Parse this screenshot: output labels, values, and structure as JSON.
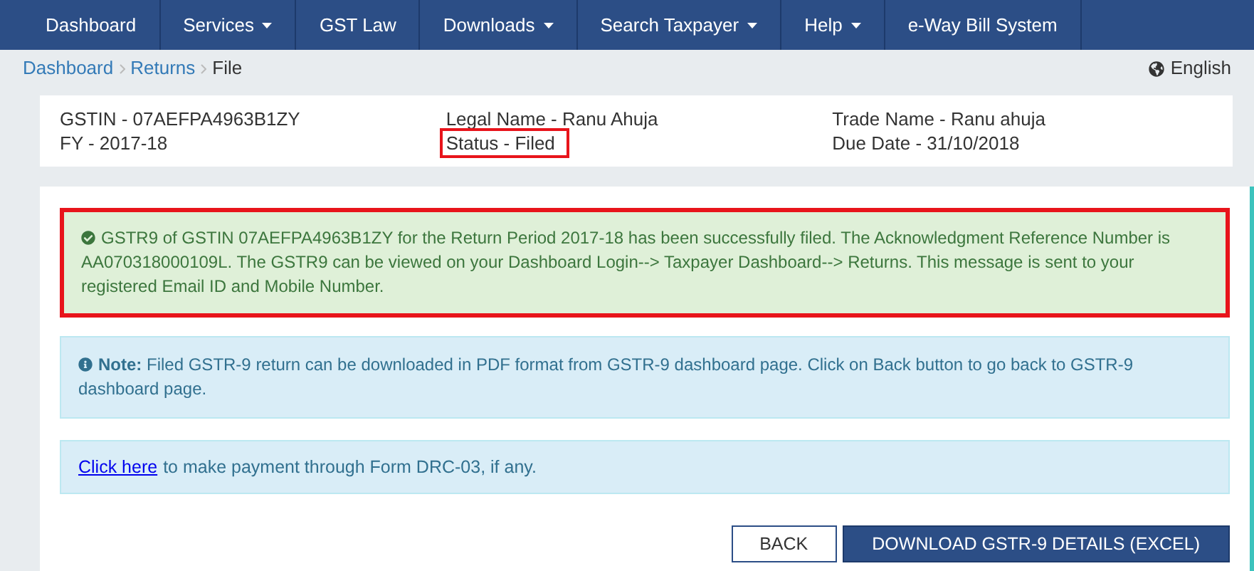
{
  "nav": [
    {
      "label": "Dashboard",
      "dropdown": false
    },
    {
      "label": "Services",
      "dropdown": true
    },
    {
      "label": "GST Law",
      "dropdown": false
    },
    {
      "label": "Downloads",
      "dropdown": true
    },
    {
      "label": "Search Taxpayer",
      "dropdown": true
    },
    {
      "label": "Help",
      "dropdown": true
    },
    {
      "label": "e-Way Bill System",
      "dropdown": false
    }
  ],
  "breadcrumb": [
    {
      "label": "Dashboard",
      "link": true
    },
    {
      "label": "Returns",
      "link": true
    },
    {
      "label": "File",
      "link": false
    }
  ],
  "language": "English",
  "info": [
    [
      {
        "text": "GSTIN - 07AEFPA4963B1ZY",
        "highlighted": false
      },
      {
        "text": "FY - 2017-18",
        "highlighted": false
      }
    ],
    [
      {
        "text": "Legal Name - Ranu Ahuja",
        "highlighted": false
      },
      {
        "text": "Status - Filed",
        "highlighted": true
      }
    ],
    [
      {
        "text": "Trade Name - Ranu ahuja",
        "highlighted": false
      },
      {
        "text": "Due Date - 31/10/2018",
        "highlighted": false
      }
    ]
  ],
  "success_alert": {
    "text": "GSTR9 of GSTIN 07AEFPA4963B1ZY for the Return Period 2017-18 has been successfully filed. The Acknowledgment Reference Number is AA070318000109L. The GSTR9 can be viewed on your Dashboard Login--> Taxpayer Dashboard--> Returns. This message is sent to your registered Email ID and Mobile Number.",
    "highlighted": true
  },
  "note": "**Note:** Filed GSTR-9 return can be downloaded in PDF format from GSTR-9 dashboard page. Click on Back button to go back to GSTR-9 dashboard page.",
  "payment": {
    "link": "Click here",
    "text": "to make payment through Form DRC-03, if any."
  },
  "buttons": [
    {
      "label": "BACK",
      "kind": "secondary"
    },
    {
      "label": "DOWNLOAD GSTR-9 DETAILS (EXCEL)",
      "kind": "primary"
    }
  ]
}
